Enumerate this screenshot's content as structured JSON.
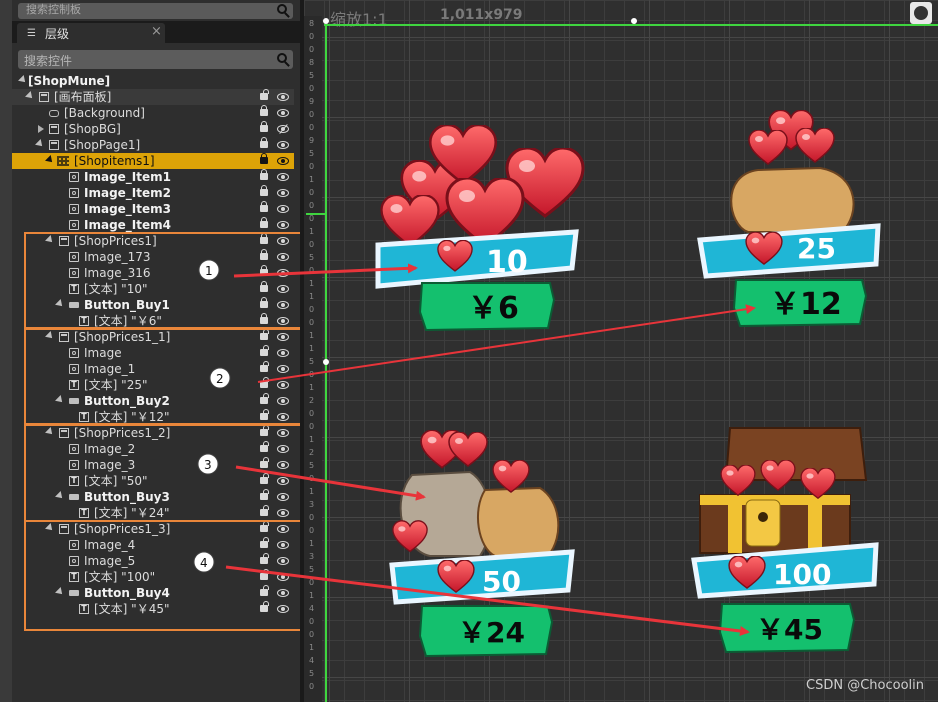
{
  "left_panel": {
    "top_search_placeholder": "搜索控制板",
    "tab_label": "层级",
    "search_placeholder": "搜索控件"
  },
  "tree": [
    {
      "label": "[ShopMune]",
      "bold": true
    },
    {
      "label": "[画布面板]"
    },
    {
      "label": "[Background]"
    },
    {
      "label": "[ShopBG]"
    },
    {
      "label": "[ShopPage1]"
    },
    {
      "label": "[Shopitems1]"
    },
    {
      "label": "Image_Item1",
      "bold": true
    },
    {
      "label": "Image_Item2",
      "bold": true
    },
    {
      "label": "Image_Item3",
      "bold": true
    },
    {
      "label": "Image_Item4",
      "bold": true
    },
    {
      "label": "[ShopPrices1]"
    },
    {
      "label": "Image_173"
    },
    {
      "label": "Image_316"
    },
    {
      "label": "[文本] \"10\""
    },
    {
      "label": "Button_Buy1",
      "bold": true
    },
    {
      "label": "[文本] \"￥6\""
    },
    {
      "label": "[ShopPrices1_1]"
    },
    {
      "label": "Image"
    },
    {
      "label": "Image_1"
    },
    {
      "label": "[文本] \"25\""
    },
    {
      "label": "Button_Buy2",
      "bold": true
    },
    {
      "label": "[文本] \"￥12\""
    },
    {
      "label": "[ShopPrices1_2]"
    },
    {
      "label": "Image_2"
    },
    {
      "label": "Image_3"
    },
    {
      "label": "[文本] \"50\""
    },
    {
      "label": "Button_Buy3",
      "bold": true
    },
    {
      "label": "[文本] \"￥24\""
    },
    {
      "label": "[ShopPrices1_3]"
    },
    {
      "label": "Image_4"
    },
    {
      "label": "Image_5"
    },
    {
      "label": "[文本] \"100\""
    },
    {
      "label": "Button_Buy4",
      "bold": true
    },
    {
      "label": "[文本] \"￥45\""
    }
  ],
  "canvas": {
    "zoom_label": "缩放1:1",
    "size_label": "1,011x979",
    "ruler_marks": [
      "8",
      "0",
      "0",
      "8",
      "5",
      "0",
      "9",
      "0",
      "0",
      "9",
      "5",
      "0",
      "1",
      "0",
      "0",
      "0",
      "1",
      "0",
      "5",
      "0",
      "1",
      "1",
      "0",
      "0",
      "1",
      "1",
      "5",
      "0",
      "1",
      "2",
      "0",
      "0",
      "1",
      "2",
      "5",
      "0",
      "1",
      "3",
      "0",
      "0",
      "1",
      "3",
      "5",
      "0",
      "1",
      "4",
      "0",
      "0",
      "1",
      "4",
      "5",
      "0"
    ]
  },
  "items": [
    {
      "count": "10",
      "price": "￥6",
      "image": "hearts-pile-icon"
    },
    {
      "count": "25",
      "price": "￥12",
      "image": "heart-sack-icon"
    },
    {
      "count": "50",
      "price": "￥24",
      "image": "heart-sacks-icon"
    },
    {
      "count": "100",
      "price": "￥45",
      "image": "treasure-chest-icon"
    }
  ],
  "callouts": [
    "1",
    "2",
    "3",
    "4"
  ],
  "colors": {
    "selection": "#dda307",
    "callout_border": "#e9863a",
    "arrow": "#e8343a",
    "count_banner": "#1fb6d6",
    "price_button": "#14c06e"
  },
  "watermark": "CSDN @Chocoolin"
}
